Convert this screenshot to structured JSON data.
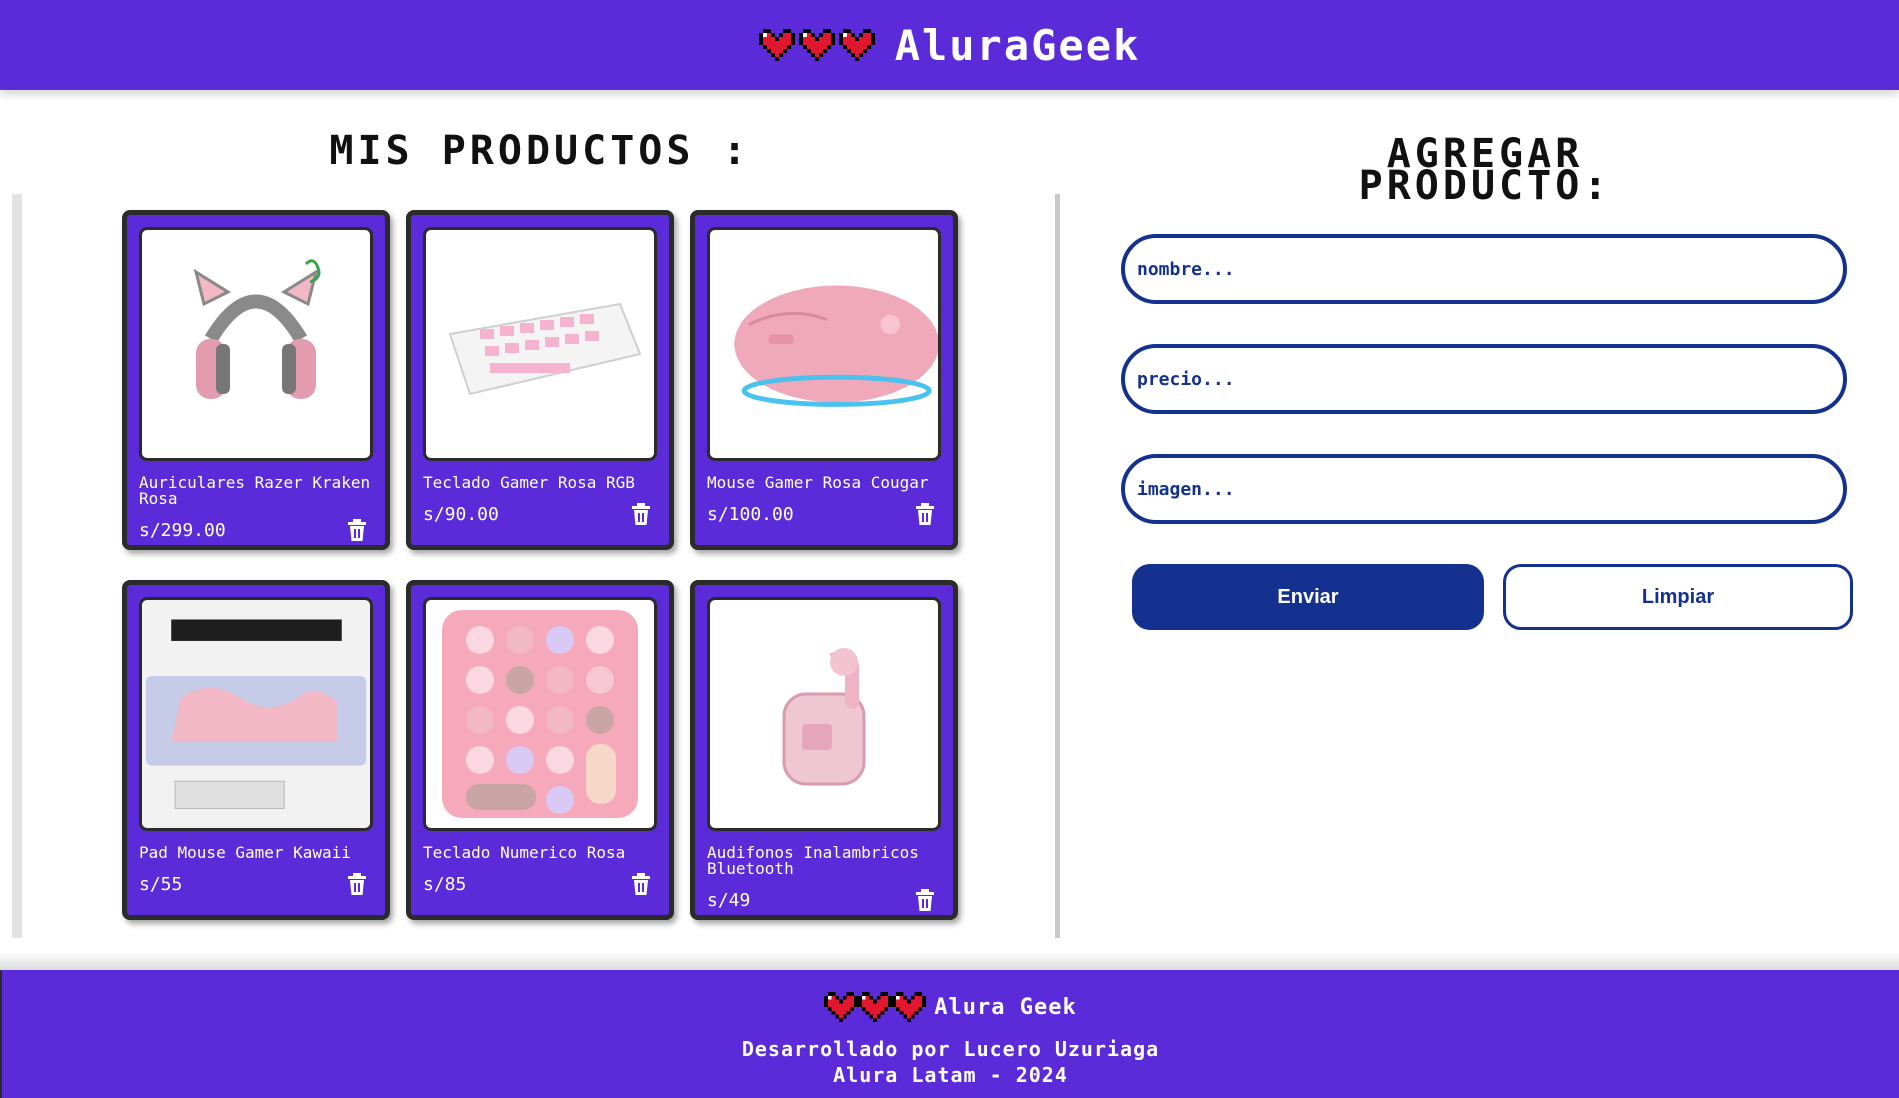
{
  "header": {
    "brand": "AluraGeek",
    "hearts": [
      "heart-icon",
      "heart-icon",
      "heart-icon"
    ]
  },
  "products_section": {
    "title": "MIS PRODUCTOS :"
  },
  "products": [
    {
      "name": "Auriculares Razer Kraken Rosa",
      "price": "s/299.00",
      "image": "pink-cat-ear-headset"
    },
    {
      "name": "Teclado Gamer Rosa RGB",
      "price": "s/90.00",
      "image": "pink-white-keyboard"
    },
    {
      "name": "Mouse Gamer Rosa Cougar",
      "price": "s/100.00",
      "image": "pink-rgb-mouse"
    },
    {
      "name": "Pad Mouse Gamer Kawaii",
      "price": "s/55",
      "image": "kawaii-mousepad"
    },
    {
      "name": "Teclado Numerico Rosa",
      "price": "s/85",
      "image": "pink-numpad"
    },
    {
      "name": "Audifonos Inalambricos Bluetooth",
      "price": "s/49",
      "image": "pink-earbuds-case"
    }
  ],
  "form": {
    "title_line1": "AGREGAR",
    "title_line2": "PRODUCTO:",
    "name_placeholder": "nombre...",
    "price_placeholder": "precio...",
    "image_placeholder": "imagen...",
    "send_label": "Enviar",
    "clear_label": "Limpiar"
  },
  "footer": {
    "brand": "Alura Geek",
    "line1": "Desarrollado por Lucero Uzuriaga",
    "line2": "Alura Latam - 2024"
  },
  "colors": {
    "primary": "#5b2bd9",
    "accent": "#15318f",
    "heart": "#e0172e",
    "card_border": "#2b2b2b"
  }
}
